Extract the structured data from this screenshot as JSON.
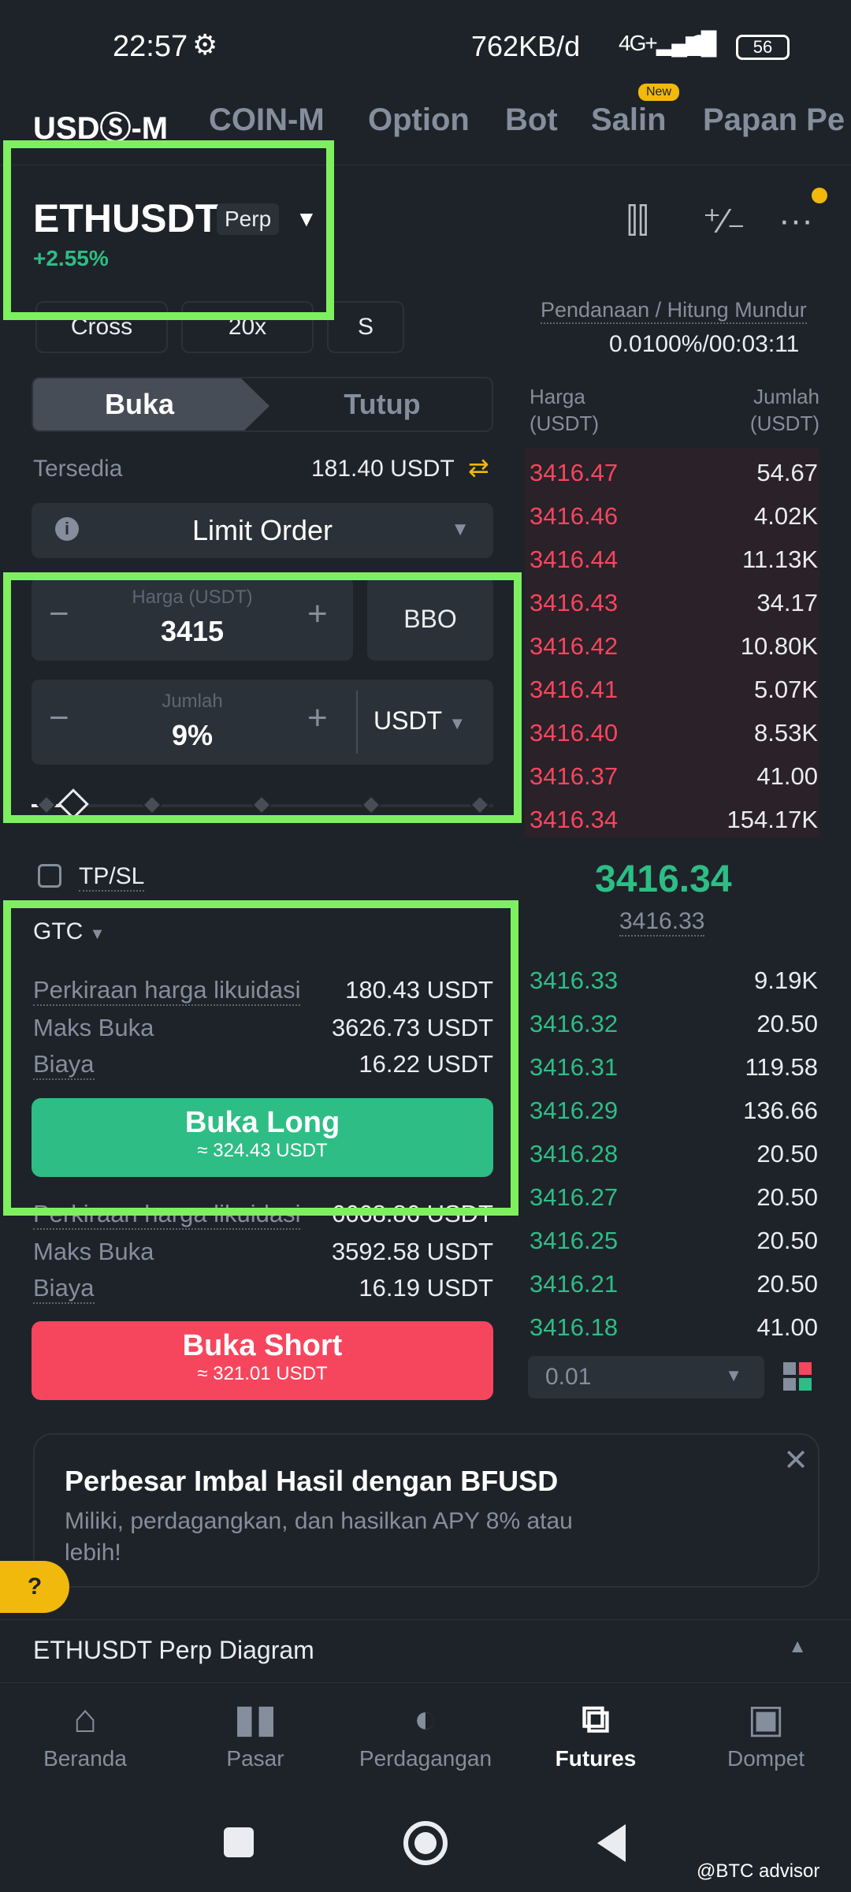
{
  "status_bar": {
    "time": "22:57",
    "net_speed": "762KB/d",
    "signal": "4G+",
    "battery": "56"
  },
  "tabs": [
    {
      "label": "USDⓈ-M",
      "active": true
    },
    {
      "label": "COIN-M",
      "active": false
    },
    {
      "label": "Option",
      "active": false
    },
    {
      "label": "Bot",
      "active": false
    },
    {
      "label": "Salin",
      "active": false,
      "badge": "New"
    },
    {
      "label": "Papan Pe",
      "active": false
    }
  ],
  "symbol": {
    "name": "ETHUSDT",
    "type": "Perp",
    "change": "+2.55%"
  },
  "margin": {
    "mode": "Cross",
    "leverage": "20x",
    "asset_mode": "S"
  },
  "funding": {
    "label": "Pendanaan / Hitung Mundur",
    "value": "0.0100%/00:03:11"
  },
  "trade_toggle": {
    "open": "Buka",
    "close": "Tutup"
  },
  "available": {
    "label": "Tersedia",
    "value": "181.40 USDT"
  },
  "order_type": "Limit Order",
  "price_input": {
    "label": "Harga (USDT)",
    "value": "3415",
    "bbo": "BBO"
  },
  "amount_input": {
    "label": "Jumlah",
    "value": "9%",
    "unit": "USDT"
  },
  "slider_percent": 9,
  "tpsl": "TP/SL",
  "tif": "GTC",
  "long_info": {
    "liq_label": "Perkiraan harga likuidasi",
    "liq_value": "180.43 USDT",
    "max_label": "Maks Buka",
    "max_value": "3626.73 USDT",
    "fee_label": "Biaya",
    "fee_value": "16.22 USDT"
  },
  "long_button": {
    "label": "Buka Long",
    "sub": "≈ 324.43 USDT"
  },
  "short_info": {
    "liq_label": "Perkiraan harga likuidasi",
    "liq_value": "6668.86 USDT",
    "max_label": "Maks Buka",
    "max_value": "3592.58 USDT",
    "fee_label": "Biaya",
    "fee_value": "16.19 USDT"
  },
  "short_button": {
    "label": "Buka Short",
    "sub": "≈ 321.01 USDT"
  },
  "orderbook": {
    "price_header": [
      "Harga",
      "(USDT)"
    ],
    "qty_header": [
      "Jumlah",
      "(USDT)"
    ],
    "asks": [
      {
        "price": "3416.47",
        "qty": "54.67"
      },
      {
        "price": "3416.46",
        "qty": "4.02K"
      },
      {
        "price": "3416.44",
        "qty": "11.13K"
      },
      {
        "price": "3416.43",
        "qty": "34.17"
      },
      {
        "price": "3416.42",
        "qty": "10.80K"
      },
      {
        "price": "3416.41",
        "qty": "5.07K"
      },
      {
        "price": "3416.40",
        "qty": "8.53K"
      },
      {
        "price": "3416.37",
        "qty": "41.00"
      },
      {
        "price": "3416.34",
        "qty": "154.17K"
      }
    ],
    "last_price": "3416.34",
    "mark_price": "3416.33",
    "bids": [
      {
        "price": "3416.33",
        "qty": "9.19K"
      },
      {
        "price": "3416.32",
        "qty": "20.50"
      },
      {
        "price": "3416.31",
        "qty": "119.58"
      },
      {
        "price": "3416.29",
        "qty": "136.66"
      },
      {
        "price": "3416.28",
        "qty": "20.50"
      },
      {
        "price": "3416.27",
        "qty": "20.50"
      },
      {
        "price": "3416.25",
        "qty": "20.50"
      },
      {
        "price": "3416.21",
        "qty": "20.50"
      },
      {
        "price": "3416.18",
        "qty": "41.00"
      }
    ],
    "tick_size": "0.01"
  },
  "banner": {
    "title": "Perbesar Imbal Hasil dengan BFUSD",
    "subtitle": "Miliki, perdagangkan, dan hasilkan APY 8% atau lebih!"
  },
  "diagram_label": "ETHUSDT Perp Diagram",
  "bottom_nav": [
    {
      "label": "Beranda",
      "icon": "home-icon",
      "active": false
    },
    {
      "label": "Pasar",
      "icon": "bar-chart-icon",
      "active": false
    },
    {
      "label": "Perdagangan",
      "icon": "trade-icon",
      "active": false
    },
    {
      "label": "Futures",
      "icon": "futures-icon",
      "active": true
    },
    {
      "label": "Dompet",
      "icon": "wallet-icon",
      "active": false
    }
  ],
  "watermark": "@BTC advisor",
  "colors": {
    "bg": "#1e2329",
    "green": "#2ebd85",
    "red": "#f6465d",
    "yellow": "#f0b90b",
    "highlight": "#7ef05f"
  }
}
